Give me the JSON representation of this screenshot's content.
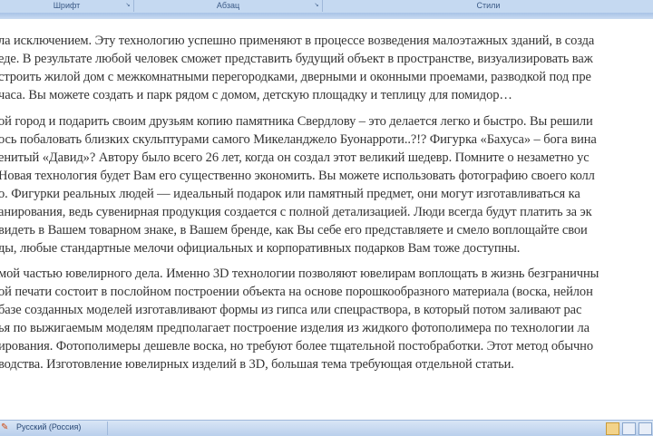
{
  "ribbon": {
    "groups": [
      {
        "label": "Шрифт"
      },
      {
        "label": "Абзац"
      },
      {
        "label": "Стили"
      }
    ]
  },
  "document": {
    "paragraphs": [
      [
        "ла исключением. Эту технологию успешно применяют в процессе возведения малоэтажных зданий, в созда",
        "еде. В результате любой человек сможет представить будущий объект в пространстве, визуализировать важ",
        "строить жилой дом с межкомнатными  перегородками, дверными и оконными проемами,  разводкой под пре",
        " часа. Вы можете создать и парк рядом с домом, детскую площадку и теплицу для помидор…"
      ],
      [
        "ой город и подарить своим друзьям копию памятника Свердлову – это делается легко и быстро. Вы решили",
        "ось побаловать близких скульптурами самого Микеланджело Буонарроти..?!? Фигурка «Бахуса» –   бога вина",
        "енитый «Давид»? Автору было всего 26 лет, когда он создал этот великий шедевр. Помните о незаметно  ус",
        "Новая технология будет Вам его существенно экономить. Вы можете использовать фотографию своего колл",
        "о. Фигурки реальных людей —  идеальный подарок или памятный предмет, они могут изготавливаться ка",
        "анирования, ведь сувенирная продукция создается с полной детализацией. Люди всегда будут платить за эк",
        "видеть в Вашем  товарном знаке, в Вашем бренде, как Вы себе его представляете и смело воплощайте свои",
        "ды, любые стандартные мелочи официальных и корпоративных подарков Вам тоже доступны."
      ],
      [
        "мой частью ювелирного дела. Именно 3D технологии позволяют ювелирам воплощать в жизнь безграничны",
        "ой  печати состоит в послойном построении объекта на основе порошкообразного материала (воска, нейлон",
        " базе созданных моделей изготавливают формы из гипса или спецраствора, в который потом заливают рас",
        "ья по выжигаемым моделям предполагает построение изделия из жидкого фотополимера по технологии ла",
        "ирования.  Фотополимеры  дешевле воска, но требуют более тщательной постобработки. Этот метод обычно",
        "водства. Изготовление ювелирных изделий в 3D, большая тема требующая отдельной статьи."
      ]
    ]
  },
  "statusbar": {
    "language": "Русский (Россия)"
  },
  "colors": {
    "ribbon": "#c5d9f1",
    "text": "#333333",
    "spelling_error": "#e03030",
    "grammar_error": "#3a9a3a"
  }
}
